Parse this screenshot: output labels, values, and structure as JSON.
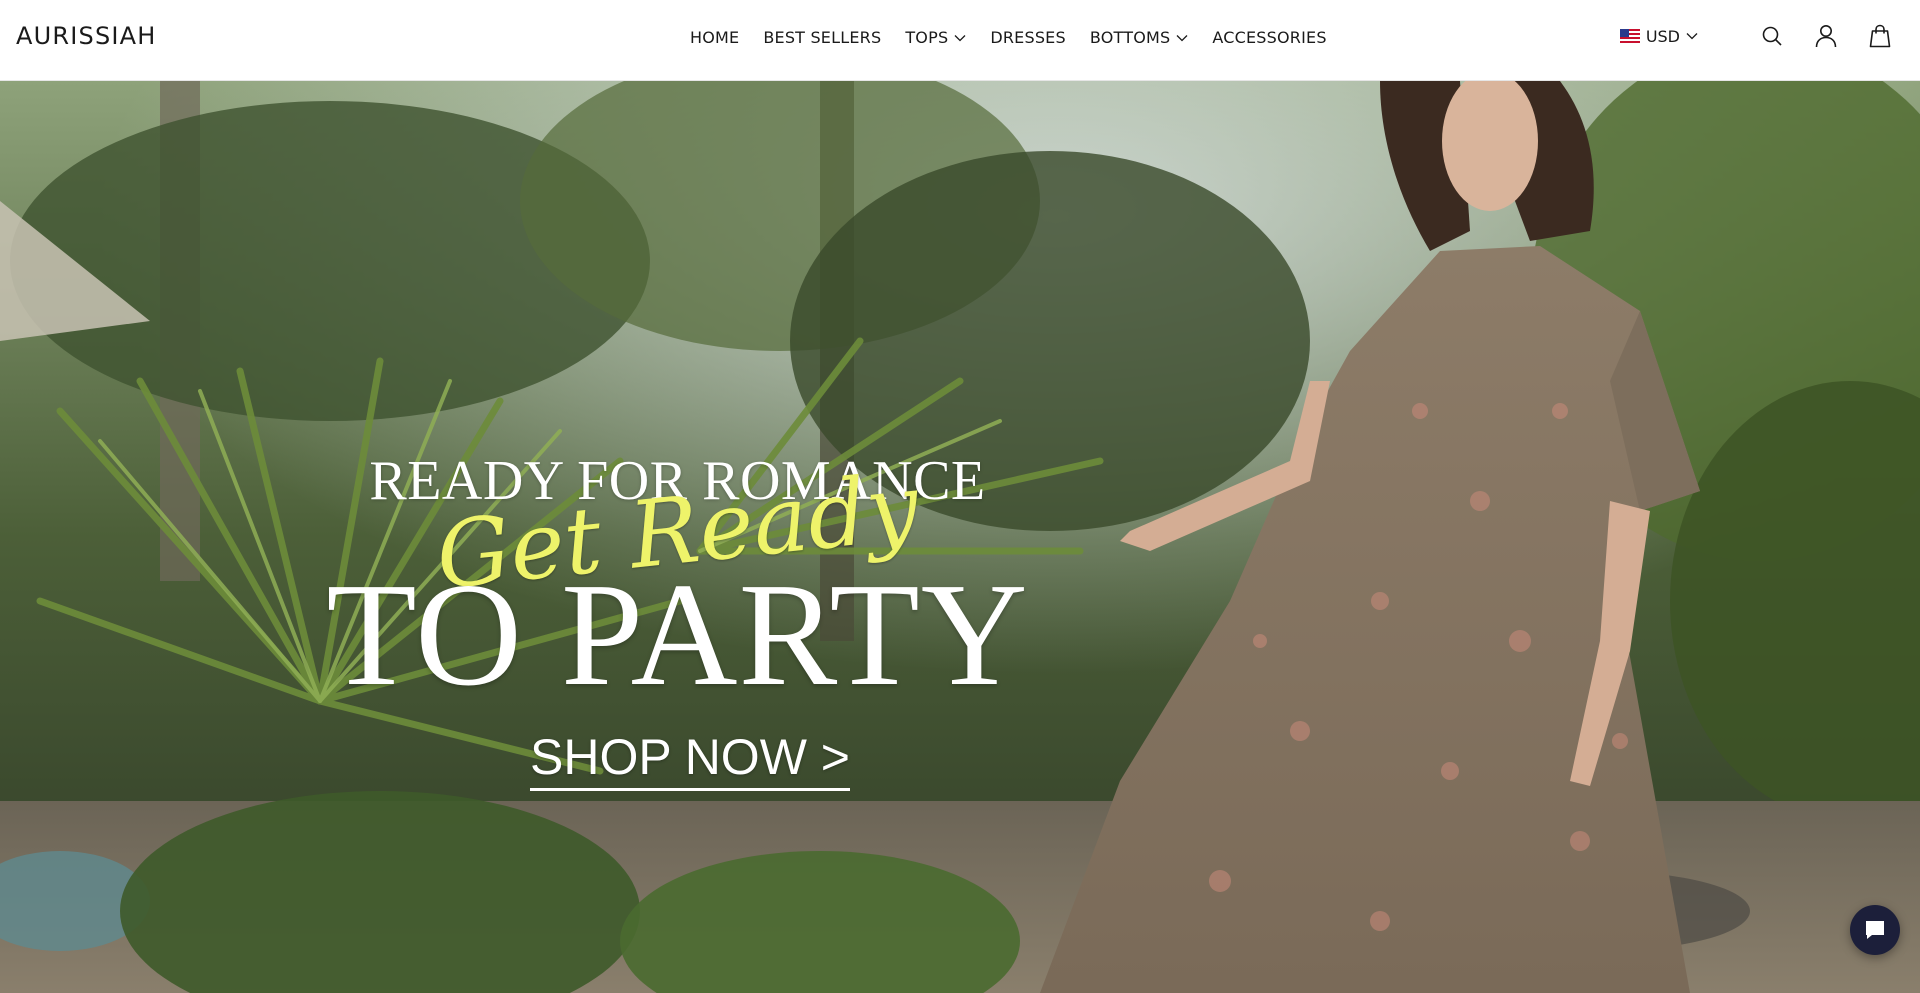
{
  "header": {
    "logo": "AURISSIAH",
    "nav": [
      {
        "label": "HOME",
        "has_dropdown": false
      },
      {
        "label": "BEST SELLERS",
        "has_dropdown": false
      },
      {
        "label": "TOPS",
        "has_dropdown": true
      },
      {
        "label": "DRESSES",
        "has_dropdown": false
      },
      {
        "label": "BOTTOMS",
        "has_dropdown": true
      },
      {
        "label": "ACCESSORIES",
        "has_dropdown": false
      }
    ],
    "currency": "USD",
    "icons": {
      "flag": "us-flag-icon",
      "search": "search-icon",
      "account": "user-icon",
      "cart": "shopping-bag-icon"
    }
  },
  "hero": {
    "line1": "READY FOR ROMANCE",
    "script": "Get Ready",
    "line2": "TO PARTY",
    "cta": "SHOP NOW >",
    "colors": {
      "headline": "#ffffff",
      "script": "#eef36a"
    }
  },
  "chat": {
    "icon": "chat-bubble-icon",
    "color": "#1c1f3a"
  }
}
